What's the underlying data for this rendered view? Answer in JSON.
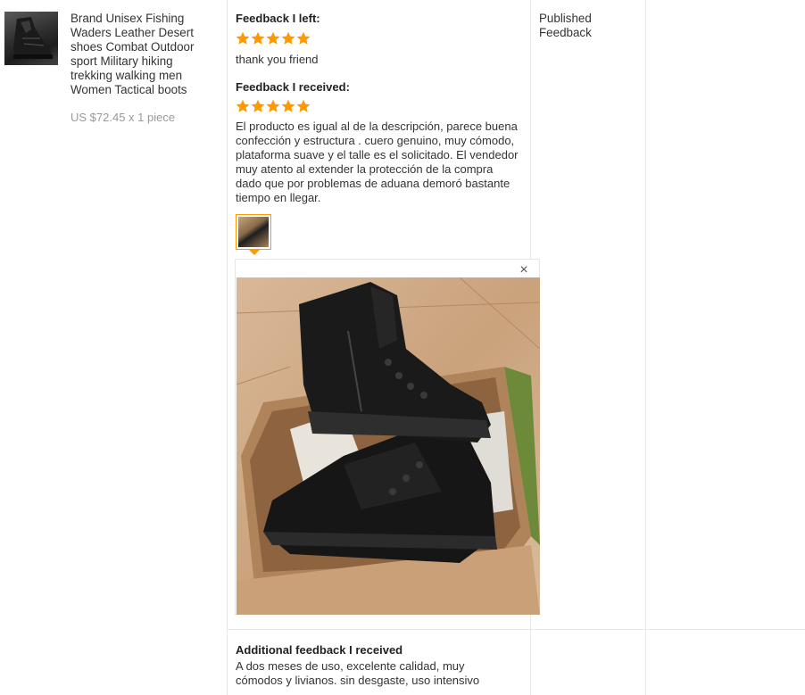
{
  "product": {
    "title": "Brand Unisex Fishing Waders Leather Desert shoes Combat Outdoor sport Military hiking trekking walking men Women Tactical boots",
    "price": "US $72.45 x 1 piece"
  },
  "feedback_left": {
    "heading": "Feedback I left:",
    "rating": 5,
    "text": "thank you friend"
  },
  "feedback_received": {
    "heading": "Feedback I received:",
    "rating": 5,
    "text": "El producto es igual al de la descripción, parece buena confección y estructura . cuero genuino, muy cómodo, plataforma suave y el talle es el solicitado. El vendedor muy atento al extender la protección de la compra dado que por problemas de aduana demoró bastante tiempo en llegar.",
    "close_glyph": "×"
  },
  "additional": {
    "heading": "Additional feedback I received",
    "text": "A dos meses de uso, excelente calidad, muy cómodos y livianos. sin desgaste, uso intensivo"
  },
  "status": {
    "label": "Published Feedback"
  },
  "colors": {
    "star": "#ff9900",
    "border": "#e8e8e8",
    "price": "#999999"
  },
  "icons": {
    "star": "star-icon",
    "close": "close-icon"
  }
}
